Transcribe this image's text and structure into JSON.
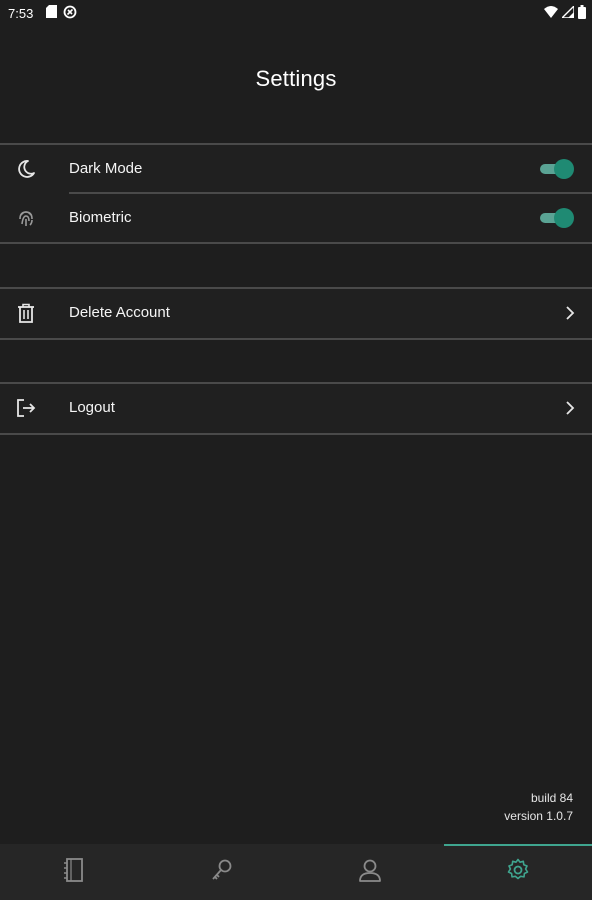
{
  "status_bar": {
    "time": "7:53",
    "left_icons": [
      "sd-card-icon",
      "vpn-key-icon"
    ],
    "right_icons": [
      "wifi-icon",
      "signal-icon",
      "battery-icon"
    ]
  },
  "header": {
    "title": "Settings"
  },
  "preferences": {
    "items": [
      {
        "label": "Dark Mode",
        "icon": "moon-icon",
        "toggle_on": true
      },
      {
        "label": "Biometric",
        "icon": "fingerprint-icon",
        "toggle_on": true
      }
    ]
  },
  "account": {
    "delete_label": "Delete Account",
    "delete_icon": "trash-icon",
    "logout_label": "Logout",
    "logout_icon": "logout-icon"
  },
  "build": {
    "build_text": "build 84",
    "version_text": "version 1.0.7"
  },
  "bottom_nav": {
    "items": [
      {
        "name": "notebook",
        "icon": "notebook-icon",
        "active": false
      },
      {
        "name": "key",
        "icon": "key-icon",
        "active": false
      },
      {
        "name": "profile",
        "icon": "person-icon",
        "active": false
      },
      {
        "name": "settings",
        "icon": "gear-icon",
        "active": true
      }
    ]
  },
  "colors": {
    "background": "#1e1e1e",
    "accent": "#1f8a73",
    "accent_light": "#5aa394",
    "text": "#f5f5f5"
  }
}
